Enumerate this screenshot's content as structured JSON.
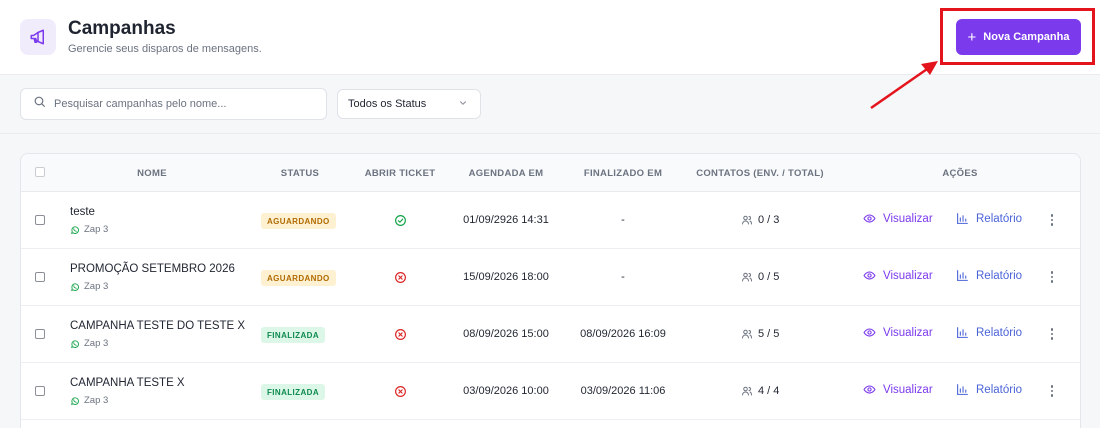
{
  "header": {
    "title": "Campanhas",
    "subtitle": "Gerencie seus disparos de mensagens.",
    "icon": "megaphone-icon",
    "new_button_label": "Nova Campanha"
  },
  "filters": {
    "search_placeholder": "Pesquisar campanhas pelo nome...",
    "search_value": "",
    "status_selected": "Todos os Status"
  },
  "table": {
    "columns": {
      "name": "NOME",
      "status": "STATUS",
      "ticket": "ABRIR TICKET",
      "scheduled": "AGENDADA EM",
      "finished": "FINALIZADO EM",
      "contacts": "CONTATOS (ENV. / TOTAL)",
      "actions": "AÇÕES"
    },
    "action_labels": {
      "view": "Visualizar",
      "report": "Relatório"
    },
    "rows": [
      {
        "name": "teste",
        "connection": "Zap 3",
        "status": "AGUARDANDO",
        "status_kind": "wait",
        "open_ticket": true,
        "scheduled": "01/09/2926 14:31",
        "finished": "-",
        "contacts": "0 / 3"
      },
      {
        "name": "PROMOÇÃO SETEMBRO 2026",
        "connection": "Zap 3",
        "status": "AGUARDANDO",
        "status_kind": "wait",
        "open_ticket": false,
        "scheduled": "15/09/2026 18:00",
        "finished": "-",
        "contacts": "0 / 5"
      },
      {
        "name": "CAMPANHA TESTE DO TESTE X",
        "connection": "Zap 3",
        "status": "FINALIZADA",
        "status_kind": "done",
        "open_ticket": false,
        "scheduled": "08/09/2026 15:00",
        "finished": "08/09/2026 16:09",
        "contacts": "5 / 5"
      },
      {
        "name": "CAMPANHA TESTE X",
        "connection": "Zap 3",
        "status": "FINALIZADA",
        "status_kind": "done",
        "open_ticket": false,
        "scheduled": "03/09/2026 10:00",
        "finished": "03/09/2026 11:06",
        "contacts": "4 / 4"
      }
    ]
  },
  "colors": {
    "accent": "#7c3aed",
    "highlight_annotation": "#e3141c",
    "ticket_yes": "#16a34a",
    "ticket_no": "#dc2626",
    "report_link": "#4a63d8"
  }
}
